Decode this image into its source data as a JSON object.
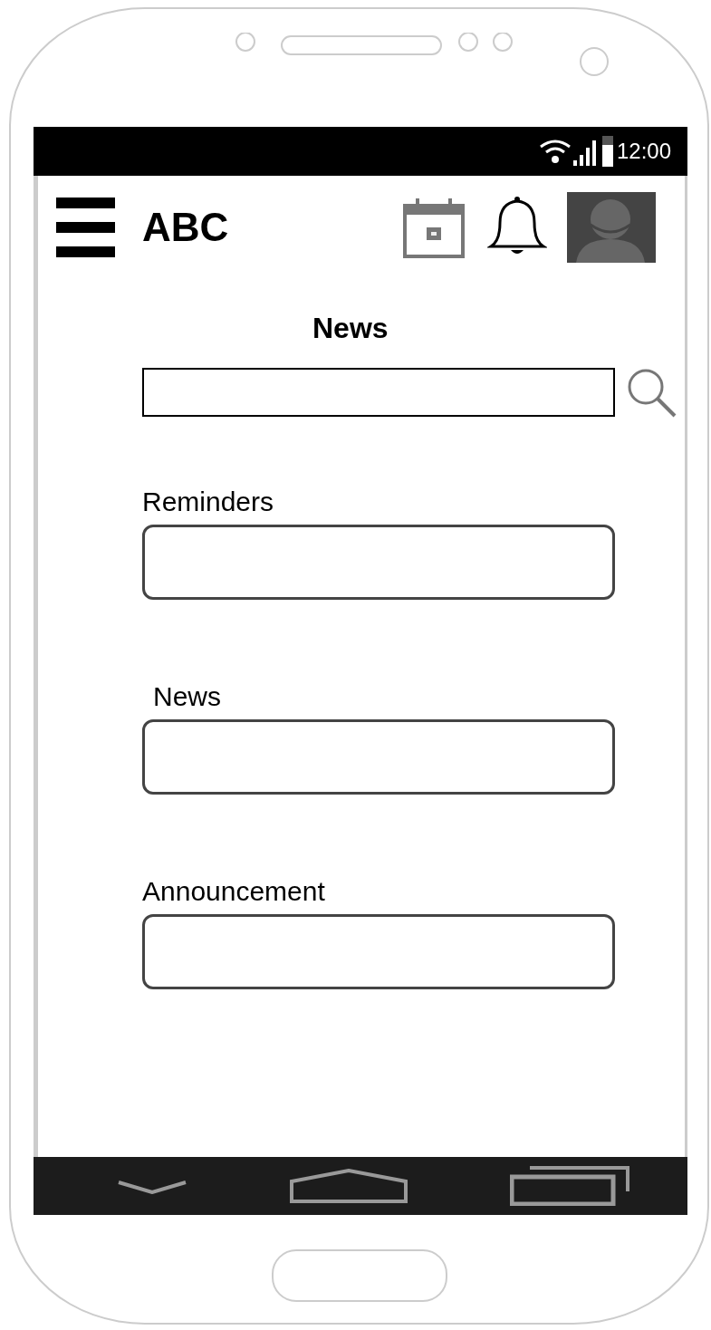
{
  "status_bar": {
    "time": "12:00"
  },
  "app_bar": {
    "title": "ABC"
  },
  "page_title": "News",
  "sections": [
    {
      "label": "Reminders"
    },
    {
      "label": "News"
    },
    {
      "label": "Announcement"
    }
  ]
}
